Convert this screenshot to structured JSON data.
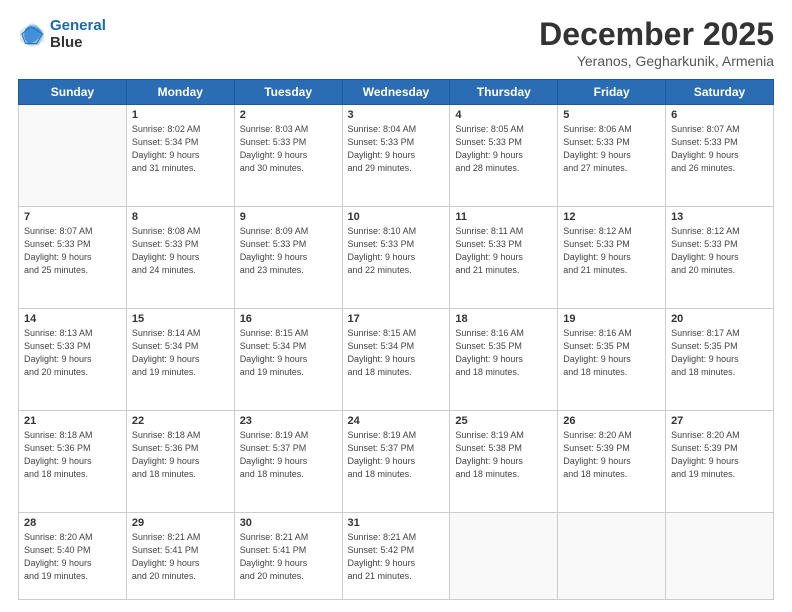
{
  "logo": {
    "line1": "General",
    "line2": "Blue"
  },
  "title": "December 2025",
  "location": "Yeranos, Gegharkunik, Armenia",
  "weekdays": [
    "Sunday",
    "Monday",
    "Tuesday",
    "Wednesday",
    "Thursday",
    "Friday",
    "Saturday"
  ],
  "weeks": [
    [
      {
        "day": "",
        "detail": ""
      },
      {
        "day": "1",
        "detail": "Sunrise: 8:02 AM\nSunset: 5:34 PM\nDaylight: 9 hours\nand 31 minutes."
      },
      {
        "day": "2",
        "detail": "Sunrise: 8:03 AM\nSunset: 5:33 PM\nDaylight: 9 hours\nand 30 minutes."
      },
      {
        "day": "3",
        "detail": "Sunrise: 8:04 AM\nSunset: 5:33 PM\nDaylight: 9 hours\nand 29 minutes."
      },
      {
        "day": "4",
        "detail": "Sunrise: 8:05 AM\nSunset: 5:33 PM\nDaylight: 9 hours\nand 28 minutes."
      },
      {
        "day": "5",
        "detail": "Sunrise: 8:06 AM\nSunset: 5:33 PM\nDaylight: 9 hours\nand 27 minutes."
      },
      {
        "day": "6",
        "detail": "Sunrise: 8:07 AM\nSunset: 5:33 PM\nDaylight: 9 hours\nand 26 minutes."
      }
    ],
    [
      {
        "day": "7",
        "detail": "Sunrise: 8:07 AM\nSunset: 5:33 PM\nDaylight: 9 hours\nand 25 minutes."
      },
      {
        "day": "8",
        "detail": "Sunrise: 8:08 AM\nSunset: 5:33 PM\nDaylight: 9 hours\nand 24 minutes."
      },
      {
        "day": "9",
        "detail": "Sunrise: 8:09 AM\nSunset: 5:33 PM\nDaylight: 9 hours\nand 23 minutes."
      },
      {
        "day": "10",
        "detail": "Sunrise: 8:10 AM\nSunset: 5:33 PM\nDaylight: 9 hours\nand 22 minutes."
      },
      {
        "day": "11",
        "detail": "Sunrise: 8:11 AM\nSunset: 5:33 PM\nDaylight: 9 hours\nand 21 minutes."
      },
      {
        "day": "12",
        "detail": "Sunrise: 8:12 AM\nSunset: 5:33 PM\nDaylight: 9 hours\nand 21 minutes."
      },
      {
        "day": "13",
        "detail": "Sunrise: 8:12 AM\nSunset: 5:33 PM\nDaylight: 9 hours\nand 20 minutes."
      }
    ],
    [
      {
        "day": "14",
        "detail": "Sunrise: 8:13 AM\nSunset: 5:33 PM\nDaylight: 9 hours\nand 20 minutes."
      },
      {
        "day": "15",
        "detail": "Sunrise: 8:14 AM\nSunset: 5:34 PM\nDaylight: 9 hours\nand 19 minutes."
      },
      {
        "day": "16",
        "detail": "Sunrise: 8:15 AM\nSunset: 5:34 PM\nDaylight: 9 hours\nand 19 minutes."
      },
      {
        "day": "17",
        "detail": "Sunrise: 8:15 AM\nSunset: 5:34 PM\nDaylight: 9 hours\nand 18 minutes."
      },
      {
        "day": "18",
        "detail": "Sunrise: 8:16 AM\nSunset: 5:35 PM\nDaylight: 9 hours\nand 18 minutes."
      },
      {
        "day": "19",
        "detail": "Sunrise: 8:16 AM\nSunset: 5:35 PM\nDaylight: 9 hours\nand 18 minutes."
      },
      {
        "day": "20",
        "detail": "Sunrise: 8:17 AM\nSunset: 5:35 PM\nDaylight: 9 hours\nand 18 minutes."
      }
    ],
    [
      {
        "day": "21",
        "detail": "Sunrise: 8:18 AM\nSunset: 5:36 PM\nDaylight: 9 hours\nand 18 minutes."
      },
      {
        "day": "22",
        "detail": "Sunrise: 8:18 AM\nSunset: 5:36 PM\nDaylight: 9 hours\nand 18 minutes."
      },
      {
        "day": "23",
        "detail": "Sunrise: 8:19 AM\nSunset: 5:37 PM\nDaylight: 9 hours\nand 18 minutes."
      },
      {
        "day": "24",
        "detail": "Sunrise: 8:19 AM\nSunset: 5:37 PM\nDaylight: 9 hours\nand 18 minutes."
      },
      {
        "day": "25",
        "detail": "Sunrise: 8:19 AM\nSunset: 5:38 PM\nDaylight: 9 hours\nand 18 minutes."
      },
      {
        "day": "26",
        "detail": "Sunrise: 8:20 AM\nSunset: 5:39 PM\nDaylight: 9 hours\nand 18 minutes."
      },
      {
        "day": "27",
        "detail": "Sunrise: 8:20 AM\nSunset: 5:39 PM\nDaylight: 9 hours\nand 19 minutes."
      }
    ],
    [
      {
        "day": "28",
        "detail": "Sunrise: 8:20 AM\nSunset: 5:40 PM\nDaylight: 9 hours\nand 19 minutes."
      },
      {
        "day": "29",
        "detail": "Sunrise: 8:21 AM\nSunset: 5:41 PM\nDaylight: 9 hours\nand 20 minutes."
      },
      {
        "day": "30",
        "detail": "Sunrise: 8:21 AM\nSunset: 5:41 PM\nDaylight: 9 hours\nand 20 minutes."
      },
      {
        "day": "31",
        "detail": "Sunrise: 8:21 AM\nSunset: 5:42 PM\nDaylight: 9 hours\nand 21 minutes."
      },
      {
        "day": "",
        "detail": ""
      },
      {
        "day": "",
        "detail": ""
      },
      {
        "day": "",
        "detail": ""
      }
    ]
  ]
}
